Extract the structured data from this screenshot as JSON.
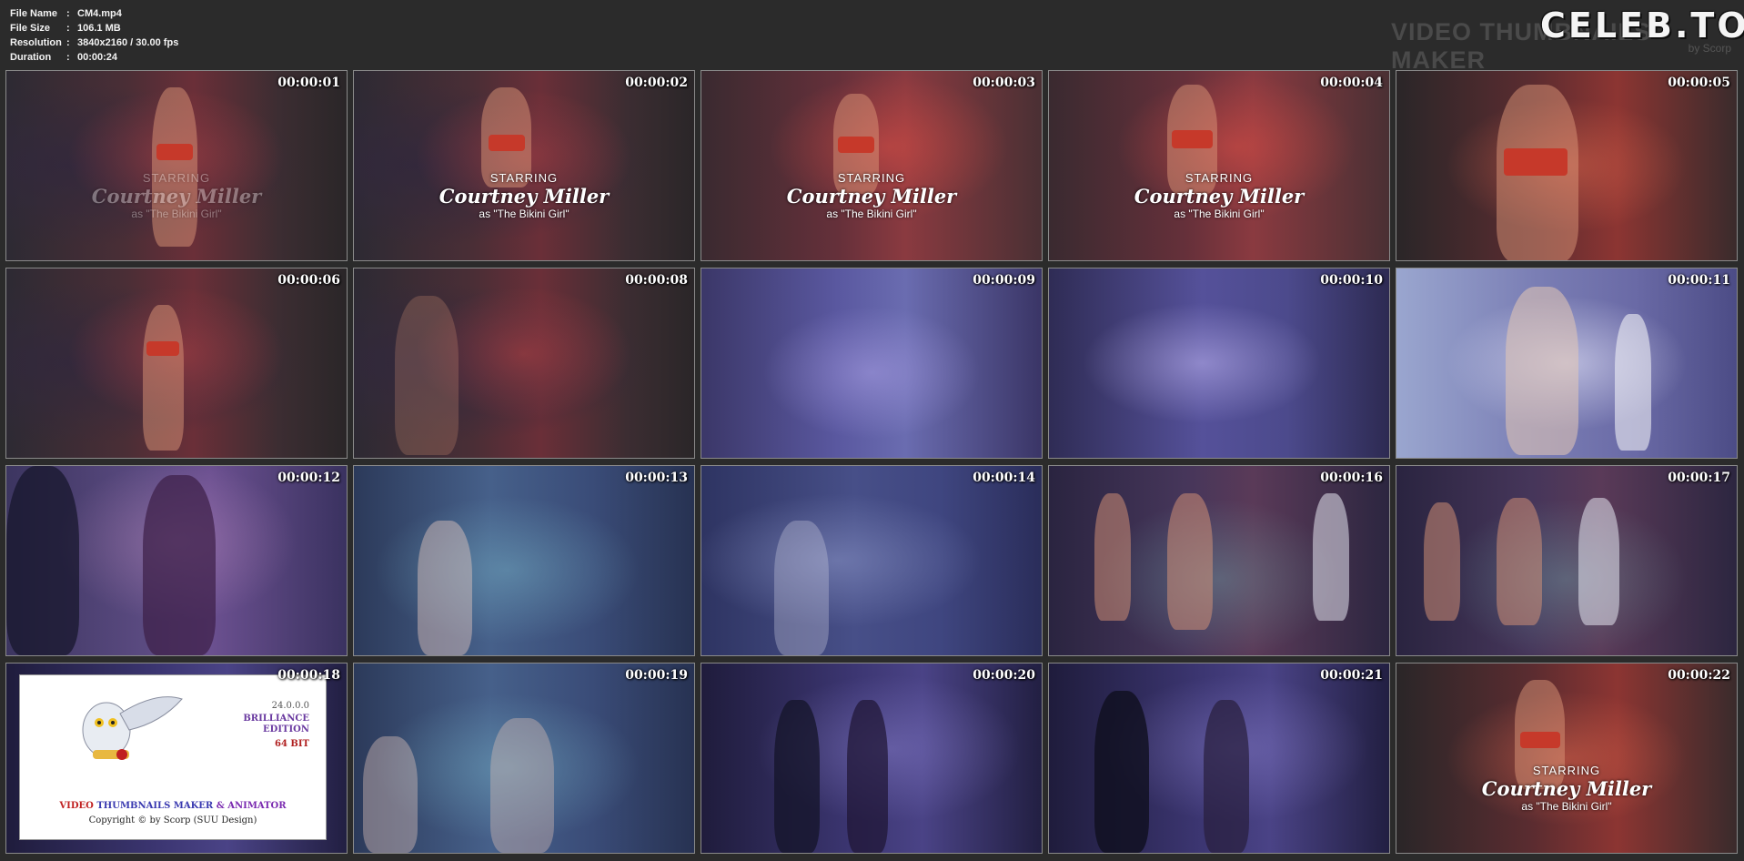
{
  "info": {
    "rows": [
      {
        "label": "File Name",
        "value": "CM4.mp4"
      },
      {
        "label": "File Size",
        "value": "106.1 MB"
      },
      {
        "label": "Resolution",
        "value": "3840x2160 / 30.00 fps"
      },
      {
        "label": "Duration",
        "value": "00:00:24"
      }
    ],
    "separator": ":"
  },
  "watermark": {
    "title": "VIDEO THUMBNAILS MAKER",
    "by": "by Scorp",
    "celeb": "CELEB.TO"
  },
  "caption": {
    "starring": "STARRING",
    "name": "Courtney Miller",
    "role": "as \"The Bikini Girl\""
  },
  "thumbnails": [
    {
      "time": "00:00:01"
    },
    {
      "time": "00:00:02"
    },
    {
      "time": "00:00:03"
    },
    {
      "time": "00:00:04"
    },
    {
      "time": "00:00:05"
    },
    {
      "time": "00:00:06"
    },
    {
      "time": "00:00:08"
    },
    {
      "time": "00:00:09"
    },
    {
      "time": "00:00:10"
    },
    {
      "time": "00:00:11"
    },
    {
      "time": "00:00:12"
    },
    {
      "time": "00:00:13"
    },
    {
      "time": "00:00:14"
    },
    {
      "time": "00:00:16"
    },
    {
      "time": "00:00:17"
    },
    {
      "time": "00:00:18"
    },
    {
      "time": "00:00:19"
    },
    {
      "time": "00:00:20"
    },
    {
      "time": "00:00:21"
    },
    {
      "time": "00:00:22"
    }
  ],
  "logo": {
    "version": "24.0.0.0",
    "edition_1": "BRILLIANCE",
    "edition_2": "EDITION",
    "bits": "64 BIT",
    "title_1": "VIDEO",
    "title_2": "THUMBNAILS MAKER",
    "title_3": "& ANIMATOR",
    "copyright": "Copyright © by Scorp (SUU Design)"
  }
}
